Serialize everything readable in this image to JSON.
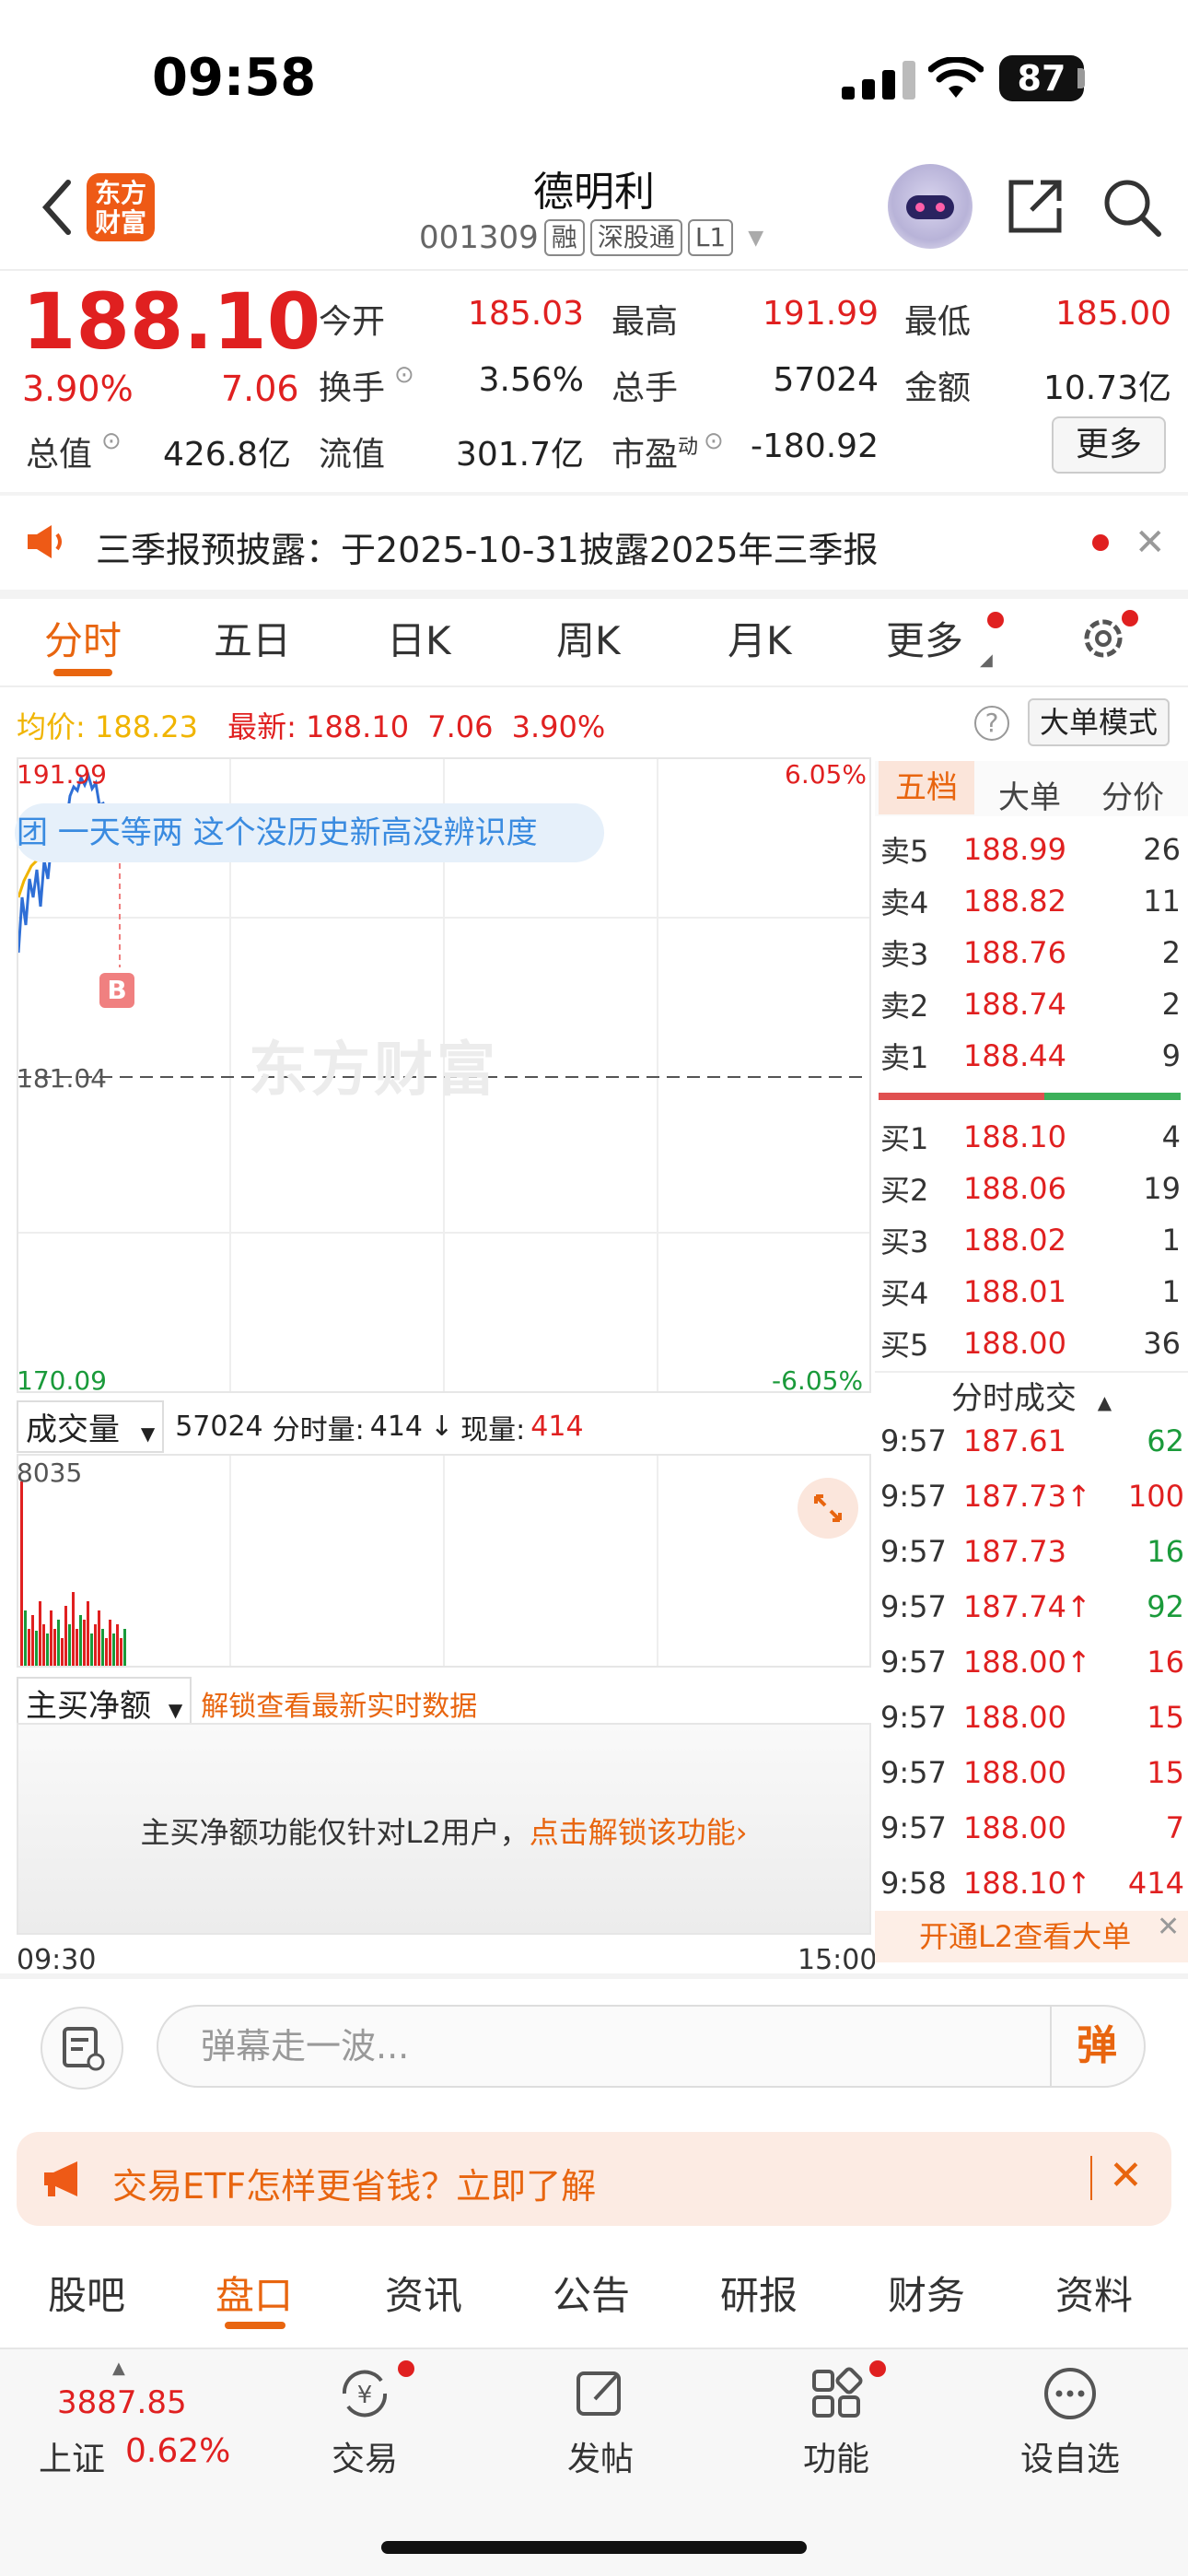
{
  "status": {
    "time": "09:58",
    "battery": "87"
  },
  "header": {
    "logo_text": "东方财富",
    "stock_name": "德明利",
    "stock_code": "001309",
    "tags": [
      "融",
      "深股通",
      "L1"
    ]
  },
  "quote": {
    "price": "188.10",
    "change_pct": "3.90%",
    "change": "7.06",
    "fields": [
      {
        "label": "今开",
        "value": "185.03",
        "color": "red"
      },
      {
        "label": "最高",
        "value": "191.99",
        "color": "red"
      },
      {
        "label": "最低",
        "value": "185.00",
        "color": "red"
      },
      {
        "label": "换手",
        "value": "3.56%",
        "color": "default"
      },
      {
        "label": "总手",
        "value": "57024",
        "color": "default"
      },
      {
        "label": "金额",
        "value": "10.73亿",
        "color": "default"
      },
      {
        "label": "总值",
        "value": "426.8亿",
        "color": "default"
      },
      {
        "label": "流值",
        "value": "301.7亿",
        "color": "default"
      },
      {
        "label": "市盈",
        "value": "-180.92",
        "color": "default"
      }
    ],
    "pe_sup": "动",
    "more_label": "更多"
  },
  "notice": {
    "text": "三季报预披露：于2025-10-31披露2025年三季报"
  },
  "chart_tabs": [
    "分时",
    "五日",
    "日K",
    "周K",
    "月K",
    "更多"
  ],
  "avg_line": {
    "avg_label": "均价:",
    "avg_value": "188.23",
    "latest_label": "最新:",
    "latest_value": "188.10",
    "change": "7.06",
    "pct": "3.90%"
  },
  "bigorder_label": "大单模式",
  "help_glyph": "?",
  "chart": {
    "y_top": "191.99",
    "y_mid": "181.04",
    "y_bottom": "170.09",
    "pct_top": "6.05%",
    "pct_bottom": "-6.05%",
    "danmu_text": "团   一天等两   这个没历史新高没辨识度",
    "b_marker": "B",
    "watermark": "东方财富"
  },
  "volume": {
    "dropdown": "成交量",
    "total": "57024",
    "minute_label": "分时量:",
    "minute_value": "414",
    "current_label": "现量:",
    "current_value": "414",
    "max": "8035"
  },
  "net_buy": {
    "dropdown": "主买净额",
    "link": "解锁查看最新实时数据",
    "message": "主买净额功能仅针对L2用户，",
    "message_link": "点击解锁该功能"
  },
  "time_axis": {
    "start": "09:30",
    "end": "15:00"
  },
  "order_book": {
    "tabs": [
      "五档",
      "大单",
      "分价"
    ],
    "asks": [
      {
        "label": "卖5",
        "price": "188.99",
        "vol": "26"
      },
      {
        "label": "卖4",
        "price": "188.82",
        "vol": "11"
      },
      {
        "label": "卖3",
        "price": "188.76",
        "vol": "2"
      },
      {
        "label": "卖2",
        "price": "188.74",
        "vol": "2"
      },
      {
        "label": "卖1",
        "price": "188.44",
        "vol": "9"
      }
    ],
    "bids": [
      {
        "label": "买1",
        "price": "188.10",
        "vol": "4"
      },
      {
        "label": "买2",
        "price": "188.06",
        "vol": "19"
      },
      {
        "label": "买3",
        "price": "188.02",
        "vol": "1"
      },
      {
        "label": "买4",
        "price": "188.01",
        "vol": "1"
      },
      {
        "label": "买5",
        "price": "188.00",
        "vol": "36"
      }
    ]
  },
  "ticks": {
    "title": "分时成交",
    "rows": [
      {
        "time": "9:57",
        "price": "187.61",
        "vol": "62",
        "vcolor": "green"
      },
      {
        "time": "9:57",
        "price": "187.73↑",
        "vol": "100",
        "vcolor": "red"
      },
      {
        "time": "9:57",
        "price": "187.73",
        "vol": "16",
        "vcolor": "green"
      },
      {
        "time": "9:57",
        "price": "187.74↑",
        "vol": "92",
        "vcolor": "green"
      },
      {
        "time": "9:57",
        "price": "188.00↑",
        "vol": "16",
        "vcolor": "red"
      },
      {
        "time": "9:57",
        "price": "188.00",
        "vol": "15",
        "vcolor": "red"
      },
      {
        "time": "9:57",
        "price": "188.00",
        "vol": "15",
        "vcolor": "red"
      },
      {
        "time": "9:57",
        "price": "188.00",
        "vol": "7",
        "vcolor": "red"
      },
      {
        "time": "9:58",
        "price": "188.10↑",
        "vol": "414",
        "vcolor": "red"
      }
    ],
    "l2_banner": "开通L2查看大单"
  },
  "comment": {
    "placeholder": "弹幕走一波...",
    "danmu_button": "弹"
  },
  "ad": {
    "text": "交易ETF怎样更省钱？立即了解"
  },
  "lower_tabs": [
    "股吧",
    "盘口",
    "资讯",
    "公告",
    "研报",
    "财务",
    "资料"
  ],
  "bottom_nav": {
    "index_value": "3887.85",
    "index_name": "上证",
    "index_pct": "0.62%",
    "items": [
      "交易",
      "发帖",
      "功能",
      "设自选"
    ]
  },
  "colors": {
    "up": "#e02020",
    "down": "#1a9a3a",
    "accent": "#e8650f",
    "avg_line": "#f0b400",
    "price_line": "#2f6fd6"
  }
}
